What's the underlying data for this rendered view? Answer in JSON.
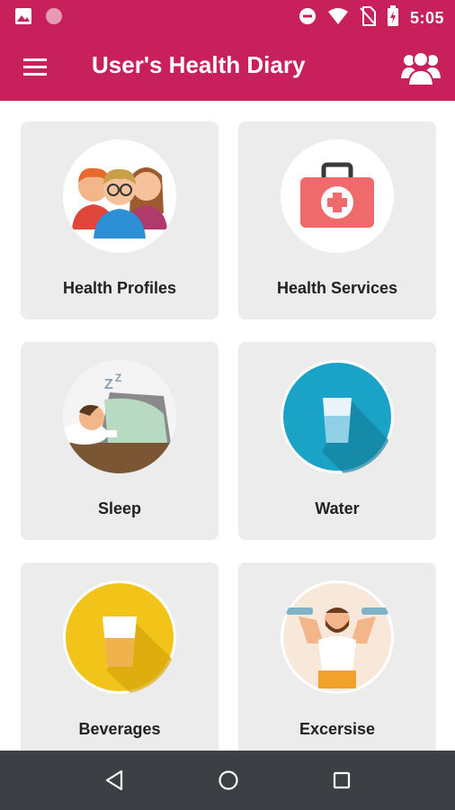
{
  "status_bar": {
    "time": "5:05",
    "left_icons": [
      "image-icon",
      "record-icon"
    ],
    "right_icons": [
      "do-not-disturb-icon",
      "wifi-icon",
      "no-sim-icon",
      "battery-icon"
    ]
  },
  "app_bar": {
    "title": "User's Health Diary",
    "menu_icon": "hamburger-menu-icon",
    "action_icon": "users-group-icon"
  },
  "cards": [
    {
      "label": "Health Profiles",
      "icon": "family-icon"
    },
    {
      "label": "Health Services",
      "icon": "first-aid-kit-icon"
    },
    {
      "label": "Sleep",
      "icon": "sleeping-person-icon"
    },
    {
      "label": "Water",
      "icon": "water-glass-icon"
    },
    {
      "label": "Beverages",
      "icon": "beverage-glass-icon"
    },
    {
      "label": "Excersise",
      "icon": "dumbbell-man-icon"
    }
  ],
  "colors": {
    "primary": "#c7205a",
    "card_bg": "#ececec",
    "nav_bg": "#3c4045"
  },
  "nav_bar": {
    "buttons": [
      "back-icon",
      "home-icon",
      "recents-icon"
    ]
  }
}
